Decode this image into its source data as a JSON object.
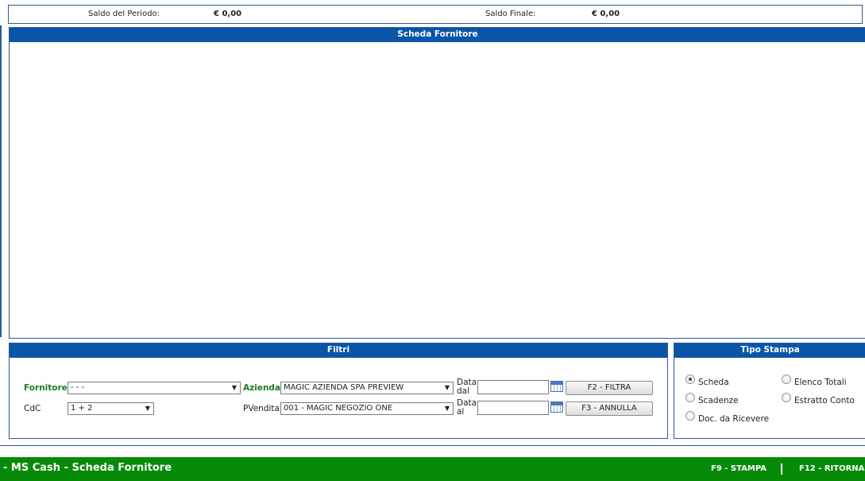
{
  "saldo": {
    "periodo_label": "Saldo del Periodo:",
    "periodo_value": "€ 0,00",
    "finale_label": "Saldo Finale:",
    "finale_value": "€ 0,00"
  },
  "scheda_panel": {
    "title": "Scheda Fornitore"
  },
  "filtri": {
    "title": "Filtri",
    "fornitore_label": "Fornitore",
    "fornitore_value": "- - -",
    "cdc_label": "CdC",
    "cdc_value": "1 + 2",
    "azienda_label": "Azienda",
    "azienda_value": "MAGIC AZIENDA SPA PREVIEW",
    "pvendita_label": "PVendita",
    "pvendita_value": "001 - MAGIC NEGOZIO ONE",
    "data_dal_label_1": "Data",
    "data_dal_label_2": "dal",
    "data_al_label_1": "Data",
    "data_al_label_2": "al",
    "data_dal_value": "",
    "data_al_value": "",
    "filtra_button": "F2 - FILTRA",
    "annulla_button": "F3 - ANNULLA"
  },
  "tipo_stampa": {
    "title": "Tipo Stampa",
    "options": [
      {
        "label": "Scheda",
        "checked": true
      },
      {
        "label": "Elenco Totali",
        "checked": false
      },
      {
        "label": "Scadenze",
        "checked": false
      },
      {
        "label": "Estratto Conto",
        "checked": false
      },
      {
        "label": "Doc. da Ricevere",
        "checked": false
      }
    ]
  },
  "footer": {
    "title": "- MS Cash - Scheda Fornitore",
    "stampa": "F9 - STAMPA",
    "ritorna": "F12 - RITORNA",
    "background": "#078a08"
  },
  "colors": {
    "header_blue": "#0a55a8",
    "label_green": "#1e7a1e"
  },
  "icons": [
    "calendar-icon",
    "dropdown-arrow-icon",
    "radio-icon"
  ]
}
